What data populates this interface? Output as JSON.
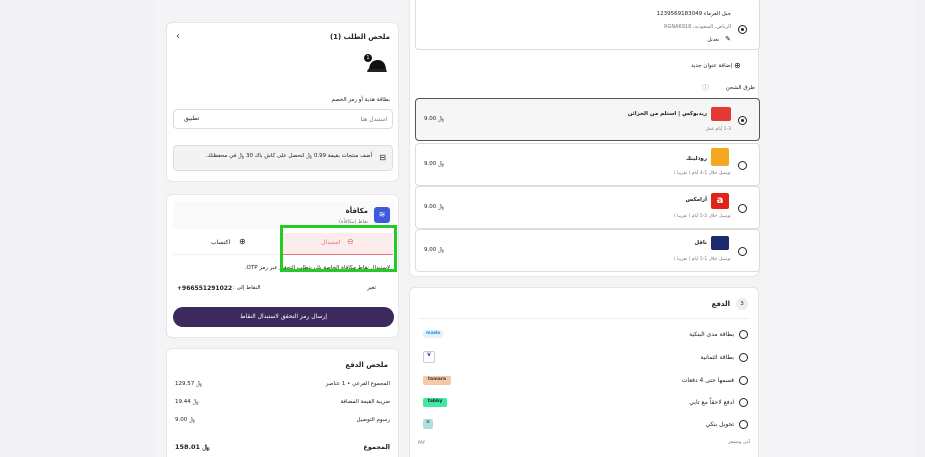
{
  "order_summary": {
    "title": "ملخص الطلب (1)",
    "item_count": "1",
    "coupon_label": "بطاقة هدية أو رمز الخصم",
    "coupon_placeholder": "استبدل هنا",
    "apply_label": "تطبيق",
    "cashback_text": "أضف منتجات بقيمة 0.99 ﷼ لتحصل على كاش باك 30 ﷼ في محفظتك."
  },
  "reward": {
    "title": "مكافأة",
    "subtitle": "نقاط (مكافأة)",
    "tab_redeem": "استبدال",
    "tab_earn": "اكتساب",
    "info": "لاستبدال نقاط مكافأة الخاصة بك، يتطلب التحقق عبر رمز OTP.",
    "phone_label": "النقاط إلى :",
    "phone": "+966551291022",
    "change_label": "تغير",
    "send_otp_button": "إرسال رمز التحقق لاستبدال النقاط"
  },
  "payment_summary": {
    "title": "ملخص الدفع",
    "rows": [
      {
        "label": "المجموع الفرعي • 1 عناصر",
        "value": "129.57 ﷼"
      },
      {
        "label": "ضريبة القيمة المضافة",
        "value": "19.44 ﷼"
      },
      {
        "label": "رسوم التوصيل",
        "value": "9.00 ﷼"
      }
    ],
    "total_label": "المجموع",
    "total_value": "158.01 ﷼"
  },
  "address": {
    "line1": "جبل العرماء 1239569183049",
    "line2": "الرياض، السعودية، RGNA6918",
    "edit_label": "تعديل",
    "add_new_label": "إضافة عنوان جديد"
  },
  "shipping": {
    "title": "طرق الشحن",
    "options": [
      {
        "name": "ريدبوكس | استلم من الخزائن",
        "desc": "1-3 أيام عمل",
        "price": "9.00 ﷼",
        "logo_color": "#e53935",
        "logo_text": "redbox",
        "selected": true
      },
      {
        "name": "رودلينك",
        "desc": "توصيل خلال 1-4 أيام ( تقريبا )",
        "price": "9.00 ﷼",
        "logo_color": "#f5a623",
        "logo_text": "RL",
        "selected": false
      },
      {
        "name": "أرامكس",
        "desc": "توصيل خلال 2-5 أيام ( تقريبا )",
        "price": "9.00 ﷼",
        "logo_color": "#e2231a",
        "logo_text": "a",
        "selected": false
      },
      {
        "name": "ناقل",
        "desc": "توصيل خلال 1-5 أيام ( تقريبا )",
        "price": "9.00 ﷼",
        "logo_color": "#1a2a6c",
        "logo_text": "naqel",
        "selected": false
      }
    ]
  },
  "payment": {
    "step": "3",
    "title": "الدفع",
    "methods": [
      {
        "label": "بطاقة مدى البنكية",
        "chip": "mada",
        "chip_color": "#1e88e5"
      },
      {
        "label": "بطاقة ائتمانية",
        "chip": "VISA",
        "chip_color": "#1a237e"
      },
      {
        "label": "قسمها حتى 4 دفعات",
        "chip": "tamara",
        "chip_color": "#f3c9a8"
      },
      {
        "label": "ادفع لاحقاً مع تابي",
        "chip": "tabby",
        "chip_color": "#3ee8a5"
      },
      {
        "label": "تحويل بنكي",
        "chip": "bank",
        "chip_color": "#4db6ac"
      }
    ],
    "secure_label": "آمن ومشفر"
  },
  "highlight_color": "#22cc22"
}
